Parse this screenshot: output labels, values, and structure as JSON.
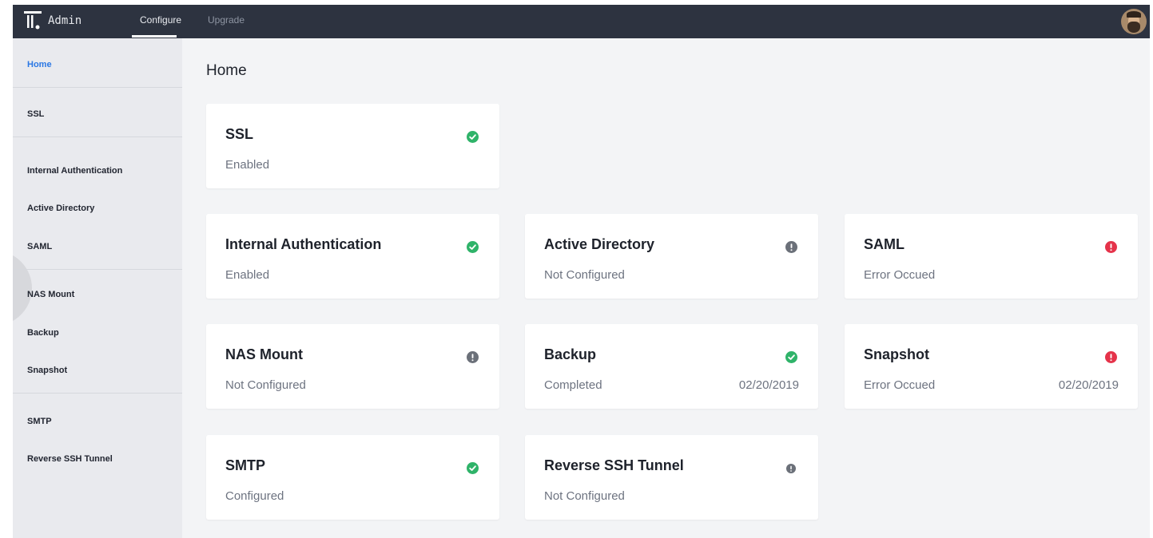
{
  "topbar": {
    "brand": "Admin",
    "tabs": [
      "Configure",
      "Upgrade"
    ],
    "active_tab": "Configure"
  },
  "sidebar": {
    "items": [
      {
        "label": "Home",
        "active": true
      },
      {
        "label": "SSL"
      },
      {
        "label": "Internal Authentication"
      },
      {
        "label": "Active Directory"
      },
      {
        "label": "SAML"
      },
      {
        "label": "NAS Mount"
      },
      {
        "label": "Backup"
      },
      {
        "label": "Snapshot"
      },
      {
        "label": "SMTP"
      },
      {
        "label": "Reverse SSH Tunnel"
      }
    ]
  },
  "main": {
    "title": "Home",
    "cards": [
      {
        "title": "SSL",
        "status": "Enabled",
        "icon": "check-circle-icon",
        "date": ""
      },
      {
        "title": "Internal Authentication",
        "status": "Enabled",
        "icon": "check-circle-icon",
        "date": ""
      },
      {
        "title": "Active Directory",
        "status": "Not Configured",
        "icon": "info-circle-icon",
        "date": ""
      },
      {
        "title": "SAML",
        "status": "Error Occued",
        "icon": "error-circle-icon",
        "date": ""
      },
      {
        "title": "NAS Mount",
        "status": "Not Configured",
        "icon": "info-circle-icon",
        "date": ""
      },
      {
        "title": "Backup",
        "status": "Completed",
        "icon": "check-circle-icon",
        "date": "02/20/2019"
      },
      {
        "title": "Snapshot",
        "status": "Error Occued",
        "icon": "error-circle-icon",
        "date": "02/20/2019"
      },
      {
        "title": "SMTP",
        "status": "Configured",
        "icon": "check-circle-icon",
        "date": ""
      },
      {
        "title": "Reverse SSH Tunnel",
        "status": "Not Configured",
        "icon": "info-circle-icon",
        "date": ""
      }
    ]
  },
  "colors": {
    "topbar": "#2d3340",
    "accent": "#2b78e4",
    "success": "#2fb369",
    "neutral": "#6b7079",
    "error": "#e5334a"
  }
}
